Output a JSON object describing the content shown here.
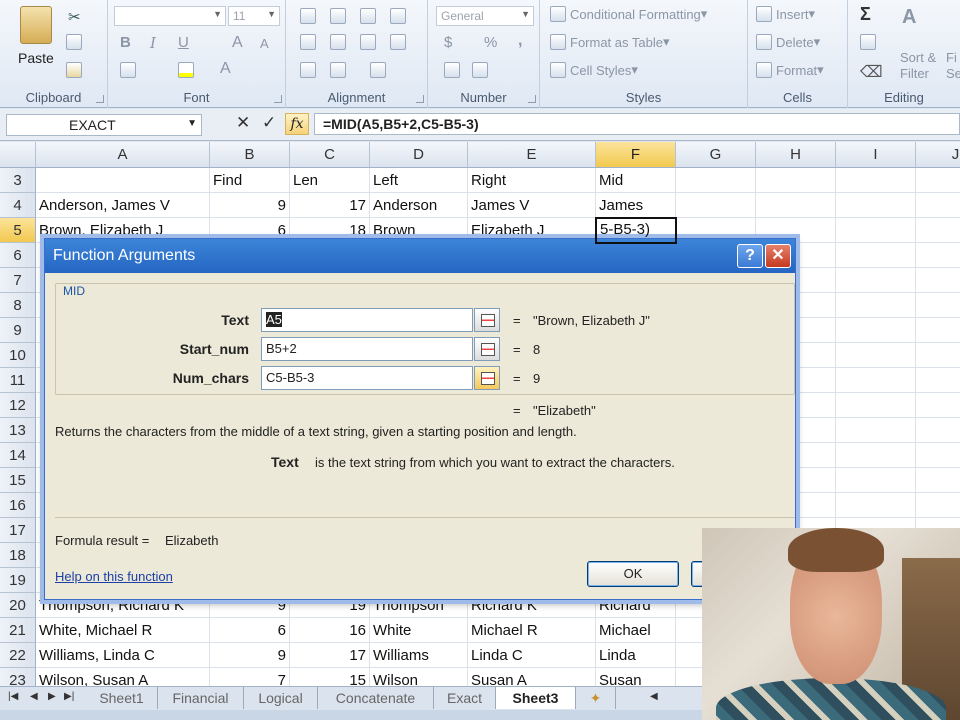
{
  "ribbon": {
    "clipboard": {
      "label": "Clipboard",
      "paste": "Paste"
    },
    "font": {
      "label": "Font",
      "size": "11",
      "bold": "B",
      "italic": "I",
      "underline": "U",
      "grow": "A",
      "shrink": "A",
      "color": "A"
    },
    "alignment": {
      "label": "Alignment"
    },
    "number": {
      "label": "Number",
      "format": "General",
      "currency": "$",
      "percent": "%",
      "comma": ","
    },
    "styles": {
      "label": "Styles",
      "conditional": "Conditional Formatting",
      "table": "Format as Table",
      "cell_styles": "Cell Styles"
    },
    "cells": {
      "label": "Cells",
      "insert": "Insert",
      "delete": "Delete",
      "format": "Format"
    },
    "editing": {
      "label": "Editing",
      "sigma": "Σ",
      "sort": "Sort &",
      "filter": "Filter",
      "s1": "Fi",
      "s2": "Se"
    }
  },
  "formula_bar": {
    "name": "EXACT",
    "cancel": "✕",
    "enter": "✓",
    "fx": "fx",
    "formula": "=MID(A5,B5+2,C5-B5-3)"
  },
  "grid": {
    "columns": [
      "A",
      "B",
      "C",
      "D",
      "E",
      "F",
      "G",
      "H",
      "I",
      "J"
    ],
    "rows_visible": [
      "3",
      "4",
      "5",
      "6",
      "7",
      "8",
      "9",
      "10",
      "11",
      "12",
      "13",
      "14",
      "15",
      "16",
      "17",
      "18",
      "19",
      "20",
      "21",
      "22",
      "23"
    ],
    "header_row": {
      "b": "Find",
      "c": "Len",
      "d": "Left",
      "e": "Right",
      "f": "Mid"
    },
    "row4": {
      "a": "Anderson, James V",
      "b": "9",
      "c": "17",
      "d": "Anderson",
      "e": "James V",
      "f": "James"
    },
    "row5": {
      "a": "Brown, Elizabeth J",
      "b": "6",
      "c": "18",
      "d": "Brown",
      "e": "Elizabeth J",
      "f": "5-B5-3)"
    },
    "row20": {
      "a": "Thompson, Richard K",
      "b": "9",
      "c": "19",
      "d": "Thompson",
      "e": "Richard K",
      "f": "Richard"
    },
    "row21": {
      "a": "White, Michael R",
      "b": "6",
      "c": "16",
      "d": "White",
      "e": "Michael R",
      "f": "Michael"
    },
    "row22": {
      "a": "Williams, Linda C",
      "b": "9",
      "c": "17",
      "d": "Williams",
      "e": "Linda C",
      "f": "Linda"
    },
    "row23": {
      "a": "Wilson, Susan A",
      "b": "7",
      "c": "15",
      "d": "Wilson",
      "e": "Susan A",
      "f": "Susan"
    }
  },
  "sheets": [
    "Sheet1",
    "Financial",
    "Logical",
    "Concatenate",
    "Exact",
    "Sheet3"
  ],
  "dialog": {
    "title": "Function Arguments",
    "help_glyph": "?",
    "close_glyph": "✕",
    "function_name": "MID",
    "args": [
      {
        "label": "Text",
        "value": "A5",
        "result": "\"Brown, Elizabeth J\""
      },
      {
        "label": "Start_num",
        "value": "B5+2",
        "result": "8"
      },
      {
        "label": "Num_chars",
        "value": "C5-B5-3",
        "result": "9"
      }
    ],
    "equals": "=",
    "overall_result": "\"Elizabeth\"",
    "description": "Returns the characters from the middle of a text string, given a starting position and length.",
    "arg_help_name": "Text",
    "arg_help_text": "is the text string from which you want to extract the characters.",
    "formula_result_label": "Formula result =",
    "formula_result_value": "Elizabeth",
    "help_link": "Help on this function",
    "ok": "OK"
  }
}
